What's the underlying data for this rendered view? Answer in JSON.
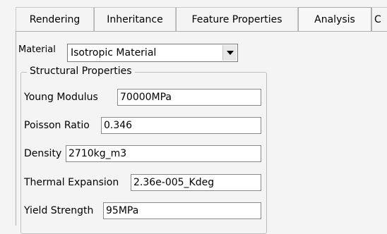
{
  "tabs": [
    {
      "label": "Rendering",
      "active": false
    },
    {
      "label": "Inheritance",
      "active": false
    },
    {
      "label": "Feature Properties",
      "active": false
    },
    {
      "label": "Analysis",
      "active": true
    },
    {
      "label": "C",
      "active": false
    }
  ],
  "material": {
    "label": "Material",
    "value": "Isotropic Material"
  },
  "structural": {
    "title": "Structural Properties",
    "fields": [
      {
        "label": "Young Modulus",
        "value": "70000MPa"
      },
      {
        "label": "Poisson Ratio",
        "value": "0.346"
      },
      {
        "label": "Density",
        "value": "2710kg_m3"
      },
      {
        "label": "Thermal Expansion",
        "value": "2.36e-005_Kdeg"
      },
      {
        "label": "Yield Strength",
        "value": "95MPa"
      }
    ]
  }
}
